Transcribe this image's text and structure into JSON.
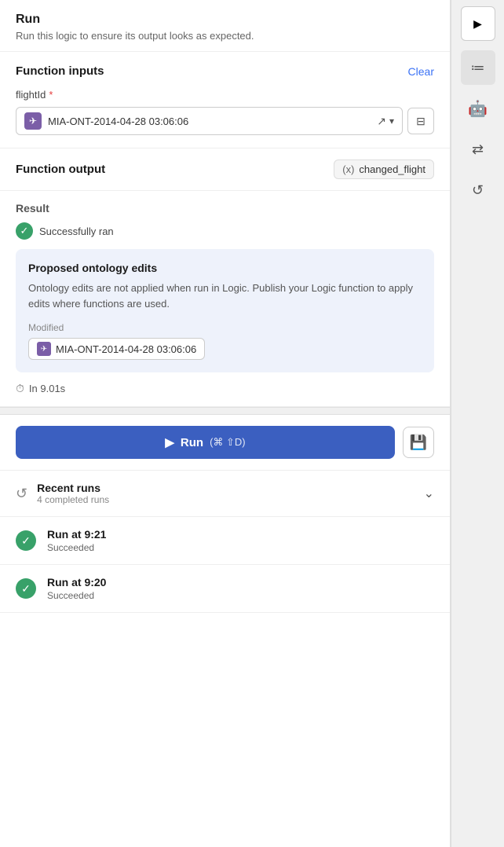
{
  "header": {
    "title": "Run",
    "subtitle": "Run this logic to ensure its output looks as expected."
  },
  "function_inputs": {
    "title": "Function inputs",
    "clear_label": "Clear",
    "field_label": "flightId",
    "required": true,
    "field_value": "MIA-ONT-2014-04-28 03:06:06"
  },
  "function_output": {
    "title": "Function output",
    "badge_icon": "(x)",
    "badge_label": "changed_flight"
  },
  "result": {
    "title": "Result",
    "success_text": "Successfully ran",
    "proposed": {
      "title": "Proposed ontology edits",
      "description": "Ontology edits are not applied when run in Logic. Publish your Logic function to apply edits where functions are used.",
      "modified_label": "Modified",
      "modified_value": "MIA-ONT-2014-04-28 03:06:06"
    },
    "timing": "In 9.01s"
  },
  "run_button": {
    "label": "Run",
    "shortcut": "(⌘ ⇧D)"
  },
  "recent_runs": {
    "title": "Recent runs",
    "subtitle": "4 completed runs",
    "runs": [
      {
        "time": "Run at 9:21",
        "status": "Succeeded"
      },
      {
        "time": "Run at 9:20",
        "status": "Succeeded"
      }
    ]
  },
  "sidebar": {
    "play_icon": "▶",
    "list_icon": "≡",
    "robot_icon": "🤖",
    "shuffle_icon": "⇄",
    "history_icon": "↺"
  }
}
